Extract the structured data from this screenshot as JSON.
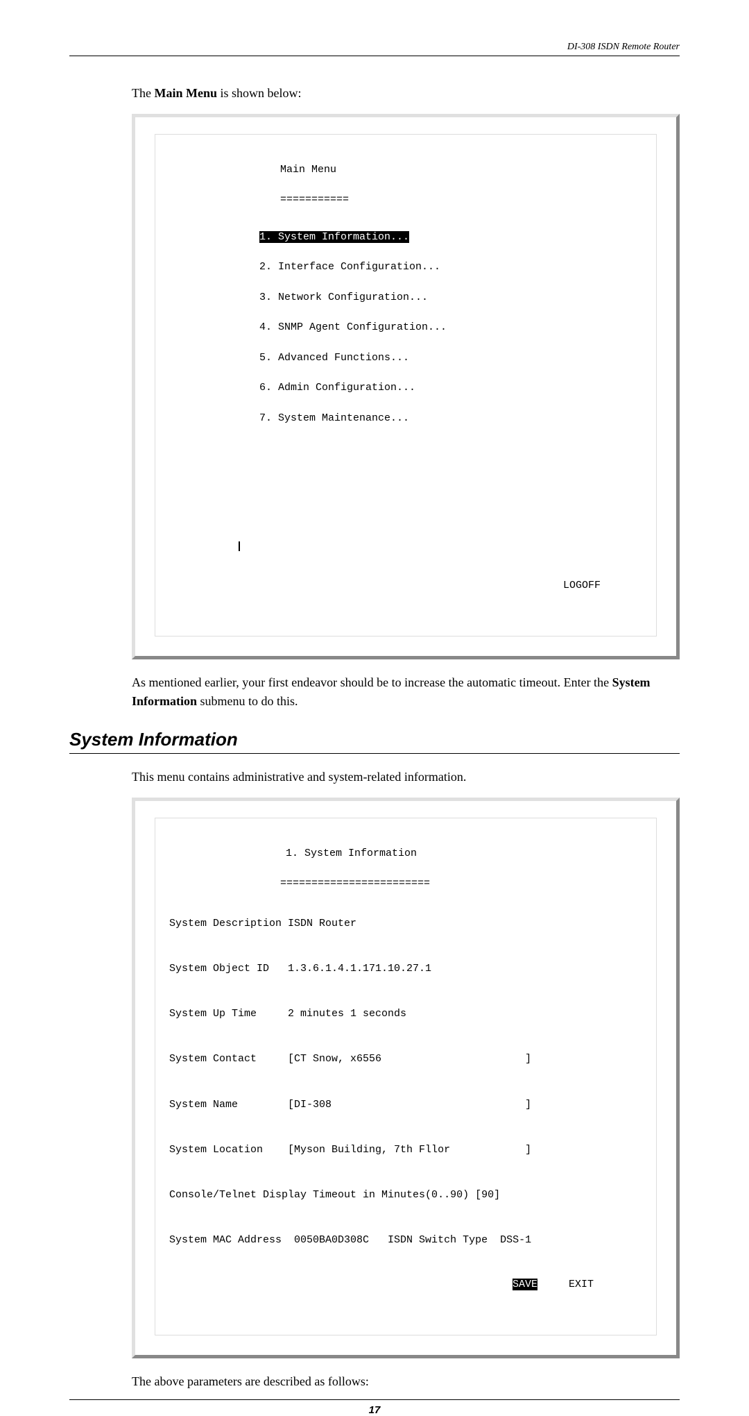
{
  "header": {
    "title": "DI-308 ISDN Remote Router"
  },
  "intro": {
    "prefix": "The ",
    "bold": "Main Menu",
    "suffix": " is shown below:"
  },
  "terminal1": {
    "title": "Main Menu",
    "divider": "===========",
    "items": [
      "1. System Information...",
      "2. Interface Configuration...",
      "3. Network Configuration...",
      "4. SNMP Agent Configuration...",
      "5. Advanced Functions...",
      "6. Admin Configuration...",
      "7. System Maintenance..."
    ],
    "logoff": "LOGOFF"
  },
  "mid_text": {
    "line1_prefix": "As mentioned earlier, your first endeavor should be to increase the automatic timeout. Enter the ",
    "line1_bold": "System Information",
    "line1_suffix": " submenu to do this."
  },
  "section": {
    "heading": "System Information",
    "desc": "This menu contains administrative and system-related information."
  },
  "terminal2": {
    "title": "1. System Information",
    "divider": "========================",
    "rows": [
      "System Description ISDN Router",
      "",
      "System Object ID   1.3.6.1.4.1.171.10.27.1",
      "",
      "System Up Time     2 minutes 1 seconds",
      "",
      "System Contact     [CT Snow, x6556                       ]",
      "",
      "System Name        [DI-308                               ]",
      "",
      "System Location    [Myson Building, 7th Fllor            ]",
      "",
      "Console/Telnet Display Timeout in Minutes(0..90) [90]",
      "",
      "System MAC Address  0050BA0D308C   ISDN Switch Type  DSS-1"
    ],
    "save": "SAVE",
    "exit": "EXIT"
  },
  "closing_text": "The above parameters are described as follows:",
  "page_number": "17"
}
